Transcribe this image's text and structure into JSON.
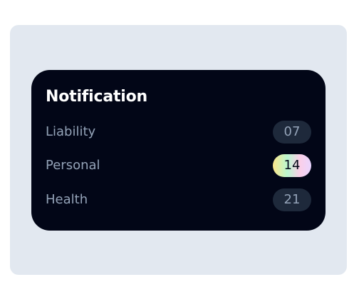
{
  "notification": {
    "title": "Notification",
    "items": [
      {
        "label": "Liability",
        "count": "07",
        "highlighted": false
      },
      {
        "label": "Personal",
        "count": "14",
        "highlighted": true
      },
      {
        "label": "Health",
        "count": "21",
        "highlighted": false
      }
    ]
  },
  "colors": {
    "outer_panel_bg": "#e2e8f0",
    "card_bg": "#020617",
    "badge_bg": "#1e293b",
    "muted_text": "#94a3b8",
    "highlight_gradient": [
      "#fde68a",
      "#bbf7d0",
      "#fbcfe8",
      "#e9d5ff"
    ]
  }
}
